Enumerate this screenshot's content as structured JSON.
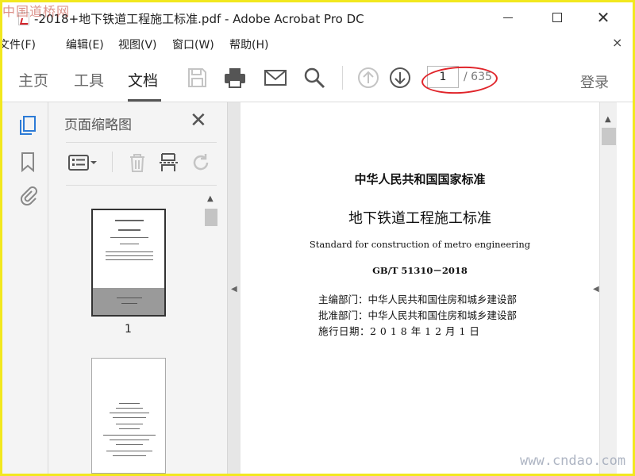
{
  "titlebar": {
    "title": "-2018+地下铁道工程施工标准.pdf - Adobe Acrobat Pro DC",
    "close_glyph": "✕"
  },
  "watermark": {
    "top": "中国道桥网",
    "bottom": "www.cndao.com"
  },
  "menubar": {
    "items": [
      "文件(F)",
      "编辑(E)",
      "视图(V)",
      "窗口(W)",
      "帮助(H)"
    ],
    "close_glyph": "×"
  },
  "toolbar": {
    "tabs": [
      "主页",
      "工具",
      "文档"
    ],
    "page_current": "1",
    "page_total": "/ 635",
    "login": "登录"
  },
  "thumbnails_panel": {
    "title": "页面缩略图",
    "close_glyph": "✕",
    "pages": [
      {
        "label": "1"
      }
    ]
  },
  "document": {
    "heading1": "中华人民共和国国家标准",
    "heading2": "地下铁道工程施工标准",
    "english_title": "Standard for construction of metro engineering",
    "code": "GB/T 51310－2018",
    "chief_editor": "主编部门：中华人民共和国住房和城乡建设部",
    "approval": "批准部门：中华人民共和国住房和城乡建设部",
    "effective_date": "施行日期：2 0 1 8  年  1 2  月  1  日"
  },
  "colors": {
    "annotation_red": "#e0242a",
    "frame_yellow": "#f2e81e"
  }
}
